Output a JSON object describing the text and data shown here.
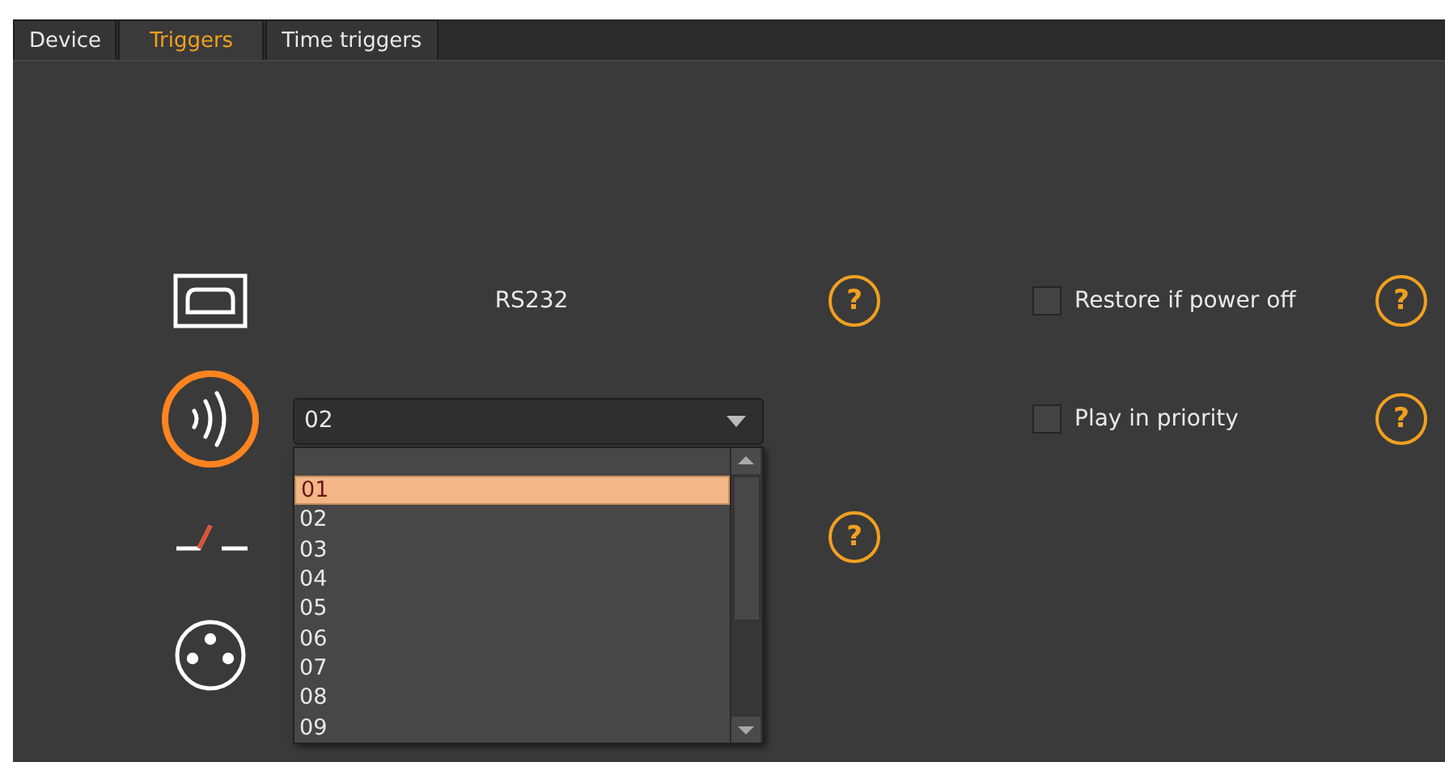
{
  "tabs": [
    {
      "label": "Device",
      "selected": false
    },
    {
      "label": "Triggers",
      "selected": true
    },
    {
      "label": "Time triggers",
      "selected": false
    }
  ],
  "triggers": [
    {
      "kind": "rs232",
      "selected": false,
      "label": "RS232",
      "help": "?"
    },
    {
      "kind": "ir",
      "selected": true,
      "dropdown": {
        "value": "02",
        "expanded": true
      }
    },
    {
      "kind": "relay",
      "selected": false,
      "help": "?"
    },
    {
      "kind": "dmx",
      "selected": false
    }
  ],
  "options": [
    {
      "label": "Restore if power off",
      "checked": false,
      "help": "?"
    },
    {
      "label": "Play in priority",
      "checked": false,
      "help": "?"
    }
  ],
  "dropdown_list": {
    "items": [
      {
        "label": "01",
        "selected": true
      },
      {
        "label": "02",
        "selected": false
      },
      {
        "label": "03",
        "selected": false
      },
      {
        "label": "04",
        "selected": false
      },
      {
        "label": "05",
        "selected": false
      },
      {
        "label": "06",
        "selected": false
      },
      {
        "label": "07",
        "selected": false
      },
      {
        "label": "08",
        "selected": false
      },
      {
        "label": "09",
        "selected": false
      }
    ]
  }
}
